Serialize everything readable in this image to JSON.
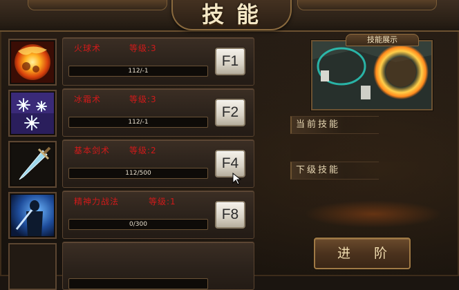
{
  "window": {
    "title": "技能"
  },
  "skills": [
    {
      "name": "火球术",
      "level": "等级:3",
      "xp": "112/-1",
      "key": "F1",
      "icon": "fireball-icon"
    },
    {
      "name": "冰霜术",
      "level": "等级:3",
      "xp": "112/-1",
      "key": "F2",
      "icon": "frost-icon"
    },
    {
      "name": "基本剑术",
      "level": "等级:2",
      "xp": "112/500",
      "key": "F4",
      "icon": "sword-icon"
    },
    {
      "name": "精神力战法",
      "level": "等级:1",
      "xp": "0/300",
      "key": "F8",
      "icon": "spirit-warrior-icon"
    },
    {
      "name": "",
      "level": "",
      "xp": "",
      "key": "",
      "icon": ""
    }
  ],
  "preview": {
    "label": "技能展示"
  },
  "info": {
    "current_label": "当前技能",
    "next_label": "下级技能"
  },
  "actions": {
    "advance_label": "进 阶"
  },
  "colors": {
    "skill_text": "#d11a1a",
    "frame_gold": "#8a6a3e",
    "panel_bg": "#2b221b"
  }
}
